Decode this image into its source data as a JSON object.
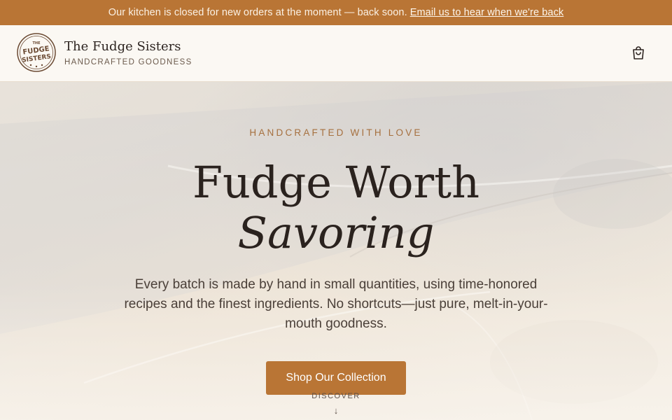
{
  "announcement": {
    "message": "Our kitchen is closed for new orders at the moment — back soon.",
    "link_label": "Email us to hear when we're back"
  },
  "header": {
    "logo_text_top": "THE",
    "logo_text_mid": "FUDGE",
    "logo_text_bottom": "SISTERS",
    "brand_name": "The Fudge Sisters",
    "tagline": "HANDCRAFTED GOODNESS",
    "cart_icon": "shopping-bag-icon"
  },
  "hero": {
    "eyebrow": "HANDCRAFTED WITH LOVE",
    "title_line1": "Fudge Worth",
    "title_line2": "Savoring",
    "subtitle": "Every batch is made by hand in small quantities, using time-honored recipes and the finest ingredients. No shortcuts—just pure, melt-in-your-mouth goodness.",
    "cta_label": "Shop Our Collection",
    "discover_label": "DISCOVER",
    "discover_arrow": "↓"
  },
  "colors": {
    "accent": "#b97535",
    "text_dark": "#2a221e",
    "background": "#fbf8f3"
  }
}
